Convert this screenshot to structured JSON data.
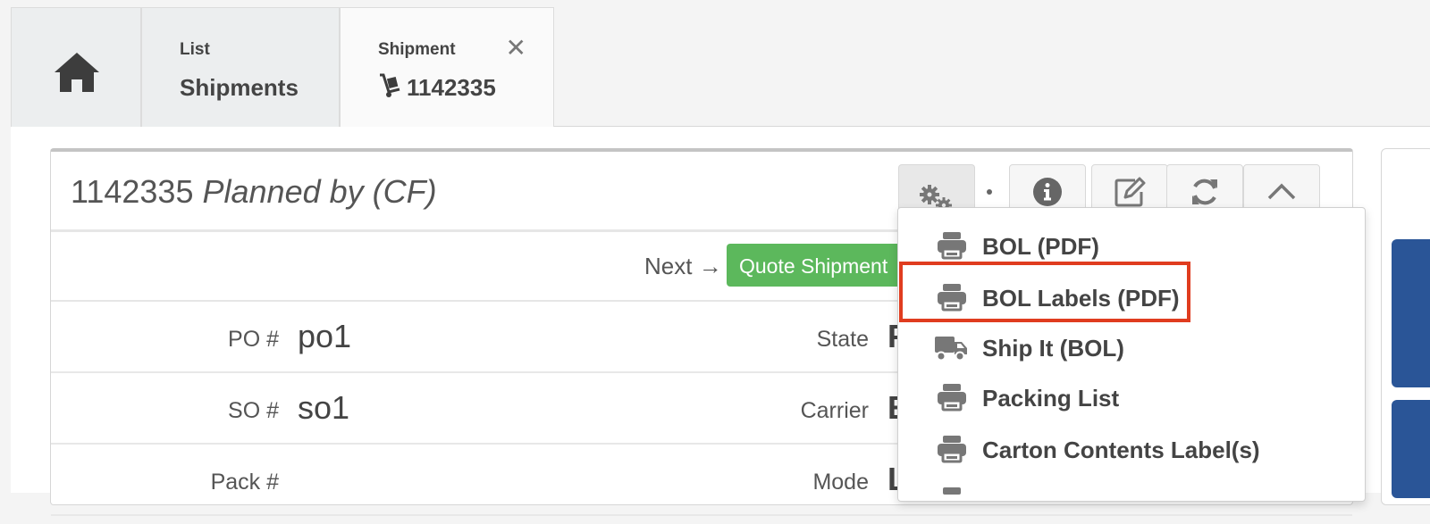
{
  "tabs": {
    "list": {
      "small": "List",
      "big": "Shipments"
    },
    "shipment": {
      "small": "Shipment",
      "big": "1142335",
      "close": "✕"
    }
  },
  "panel": {
    "title_number": "1142335",
    "title_sub": "Planned by (CF)"
  },
  "next_row": {
    "label": "Next",
    "arrow": "→",
    "button": "Quote Shipment"
  },
  "fields": [
    {
      "label": "PO #",
      "value": "po1",
      "label2": "State",
      "value2": "F"
    },
    {
      "label": "SO #",
      "value": "so1",
      "label2": "Carrier",
      "value2": "E"
    },
    {
      "label": "Pack #",
      "value": "",
      "label2": "Mode",
      "value2": "L"
    }
  ],
  "menu": {
    "items": [
      {
        "label": "BOL (PDF)",
        "icon": "printer-icon"
      },
      {
        "label": "BOL Labels (PDF)",
        "icon": "printer-icon"
      },
      {
        "label": "Ship It (BOL)",
        "icon": "truck-icon"
      },
      {
        "label": "Packing List",
        "icon": "printer-icon"
      },
      {
        "label": "Carton Contents Label(s)",
        "icon": "printer-icon"
      }
    ]
  },
  "colors": {
    "quote_button": "#5cb85c",
    "highlight": "#e03c1f",
    "accent_blue": "#2a5597"
  }
}
